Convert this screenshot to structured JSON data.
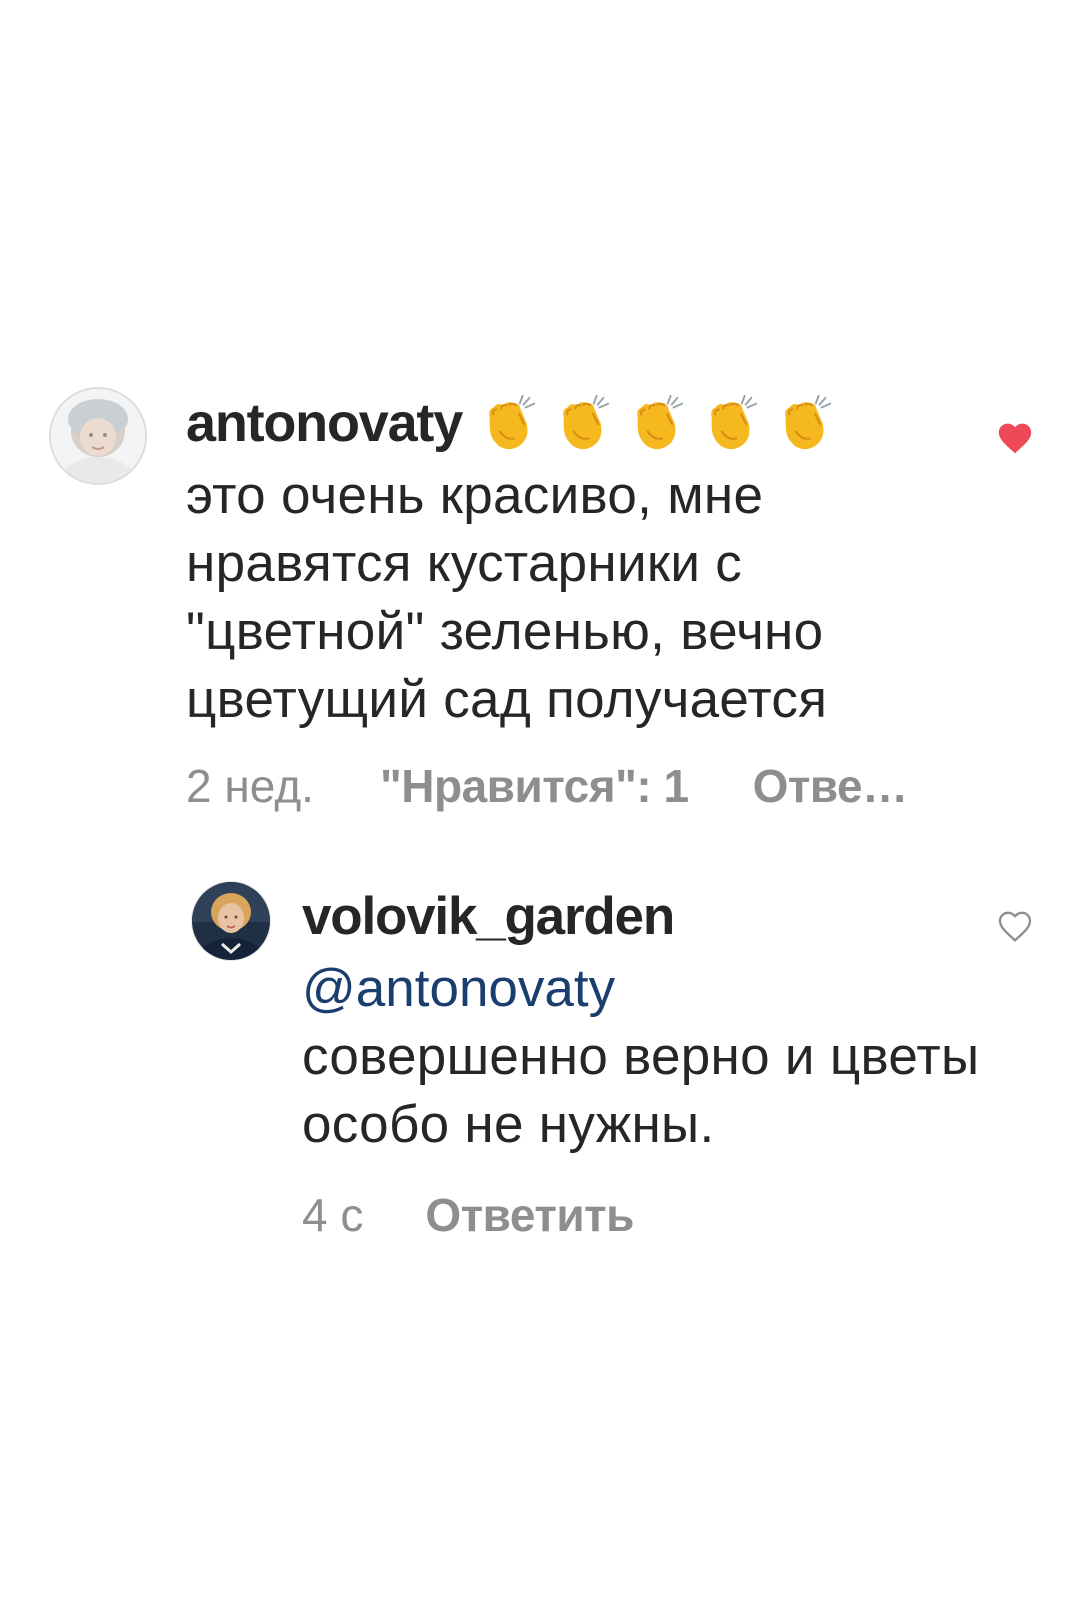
{
  "comments": [
    {
      "username": "antonovaty",
      "emoji": "👏👏👏👏👏",
      "text": "это очень красиво, мне нравятся кустарники с \"цветной\" зеленью, вечно цветущий сад получается",
      "time": "2 нед.",
      "likes": "\"Нравится\": 1",
      "reply": "Отве…",
      "liked": true,
      "icon": "heart-filled-icon",
      "like_color": "#ed4956"
    },
    {
      "username": "volovik_garden",
      "mention": "@antonovaty",
      "text": "совершенно верно и цветы особо не нужны.",
      "time": "4 с",
      "reply": "Ответить",
      "liked": false,
      "icon": "heart-outline-icon",
      "mention_color": "#1a3f6e"
    }
  ]
}
